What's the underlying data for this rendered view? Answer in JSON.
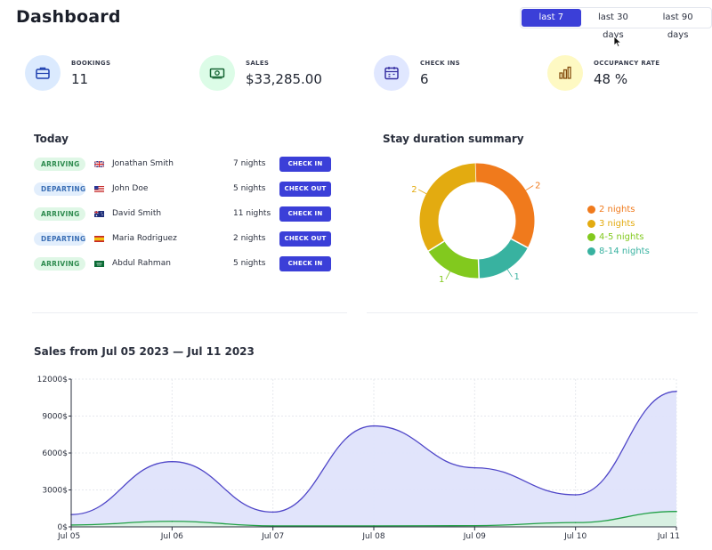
{
  "header": {
    "title": "Dashboard",
    "ranges": [
      {
        "label": "last 7 days",
        "active": true
      },
      {
        "label": "last 30 days",
        "active": false
      },
      {
        "label": "last 90 days",
        "active": false
      }
    ]
  },
  "kpis": [
    {
      "label": "BOOKINGS",
      "value": "11",
      "icon": "briefcase-icon",
      "icon_bg": "#dbeafe",
      "icon_color": "#1e40af"
    },
    {
      "label": "SALES",
      "value": "$33,285.00",
      "icon": "banknote-icon",
      "icon_bg": "#dcfce7",
      "icon_color": "#166534"
    },
    {
      "label": "CHECK INS",
      "value": "6",
      "icon": "calendar-icon",
      "icon_bg": "#e0e7ff",
      "icon_color": "#3730a3"
    },
    {
      "label": "OCCUPANCY RATE",
      "value": "48 %",
      "icon": "bar-chart-icon",
      "icon_bg": "#fef9c3",
      "icon_color": "#854d0e"
    }
  ],
  "today": {
    "title": "Today",
    "rows": [
      {
        "status": "ARRIVING",
        "status_type": "arriving",
        "country": "gb",
        "name": "Jonathan Smith",
        "nights": "7 nights",
        "action": "CHECK IN"
      },
      {
        "status": "DEPARTING",
        "status_type": "departing",
        "country": "us",
        "name": "John Doe",
        "nights": "5 nights",
        "action": "CHECK OUT"
      },
      {
        "status": "ARRIVING",
        "status_type": "arriving",
        "country": "au",
        "name": "David Smith",
        "nights": "11 nights",
        "action": "CHECK IN"
      },
      {
        "status": "DEPARTING",
        "status_type": "departing",
        "country": "es",
        "name": "Maria Rodriguez",
        "nights": "2 nights",
        "action": "CHECK OUT"
      },
      {
        "status": "ARRIVING",
        "status_type": "arriving",
        "country": "sa",
        "name": "Abdul Rahman",
        "nights": "5 nights",
        "action": "CHECK IN"
      }
    ]
  },
  "stay_summary": {
    "title": "Stay duration summary"
  },
  "sales": {
    "title": "Sales from Jul 05 2023 — Jul 11 2023"
  },
  "chart_data": [
    {
      "type": "pie",
      "title": "Stay duration summary",
      "categories": [
        "2 nights",
        "3 nights",
        "4-5 nights",
        "8-14 nights"
      ],
      "values": [
        2,
        2,
        1,
        1
      ],
      "colors": [
        "#f07a1c",
        "#e3ab10",
        "#82c91e",
        "#38b2a0"
      ],
      "legend": "right",
      "hole": true
    },
    {
      "type": "area",
      "title": "Sales from Jul 05 2023 — Jul 11 2023",
      "categories": [
        "Jul 05",
        "Jul 06",
        "Jul 07",
        "Jul 08",
        "Jul 09",
        "Jul 10",
        "Jul 11"
      ],
      "series": [
        {
          "values": [
            1000,
            5300,
            1200,
            8200,
            4800,
            2600,
            11000
          ],
          "color": "#4f46c8",
          "fill": "#dfe3fb"
        },
        {
          "values": [
            150,
            450,
            80,
            80,
            100,
            350,
            1250
          ],
          "color": "#22a047",
          "fill": "#d7f1df"
        }
      ],
      "yticks": [
        "0$",
        "3000$",
        "6000$",
        "9000$",
        "12000$"
      ],
      "ylim": [
        0,
        12000
      ],
      "grid": true
    }
  ]
}
